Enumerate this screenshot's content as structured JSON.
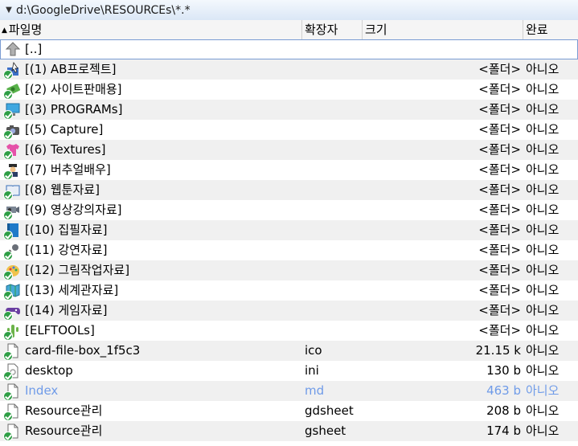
{
  "path_bar": {
    "path": "d:\\GoogleDrive\\RESOURCEs\\*.*"
  },
  "columns": {
    "name": "파일명",
    "ext": "확장자",
    "size": "크기",
    "done": "완료"
  },
  "rows": [
    {
      "name": "[..]",
      "ext": "",
      "size": "",
      "done": "",
      "icon": "up-folder-icon"
    },
    {
      "name": "[(1) AB프로젝트]",
      "ext": "",
      "size": "<폴더>",
      "done": "아니오",
      "icon": "cursor-folder-icon"
    },
    {
      "name": "[(2) 사이트판매용]",
      "ext": "",
      "size": "<폴더>",
      "done": "아니오",
      "icon": "money-icon"
    },
    {
      "name": "[(3) PROGRAMs]",
      "ext": "",
      "size": "<폴더>",
      "done": "아니오",
      "icon": "computer-icon"
    },
    {
      "name": "[(5) Capture]",
      "ext": "",
      "size": "<폴더>",
      "done": "아니오",
      "icon": "camera-icon"
    },
    {
      "name": "[(6) Textures]",
      "ext": "",
      "size": "<폴더>",
      "done": "아니오",
      "icon": "tshirt-icon"
    },
    {
      "name": "[(7) 버추얼배우]",
      "ext": "",
      "size": "<폴더>",
      "done": "아니오",
      "icon": "pilot-icon"
    },
    {
      "name": "[(8) 웹툰자료]",
      "ext": "",
      "size": "<폴더>",
      "done": "아니오",
      "icon": "book-icon"
    },
    {
      "name": "[(9) 영상강의자료]",
      "ext": "",
      "size": "<폴더>",
      "done": "아니오",
      "icon": "projector-icon"
    },
    {
      "name": "[(10) 집필자료]",
      "ext": "",
      "size": "<폴더>",
      "done": "아니오",
      "icon": "notebook-icon"
    },
    {
      "name": "[(11) 강연자료]",
      "ext": "",
      "size": "<폴더>",
      "done": "아니오",
      "icon": "microphone-icon"
    },
    {
      "name": "[(12) 그림작업자료]",
      "ext": "",
      "size": "<폴더>",
      "done": "아니오",
      "icon": "palette-icon"
    },
    {
      "name": "[(13) 세계관자료]",
      "ext": "",
      "size": "<폴더>",
      "done": "아니오",
      "icon": "map-icon"
    },
    {
      "name": "[(14) 게임자료]",
      "ext": "",
      "size": "<폴더>",
      "done": "아니오",
      "icon": "gamepad-icon"
    },
    {
      "name": "[ELFTOOLs]",
      "ext": "",
      "size": "<폴더>",
      "done": "아니오",
      "icon": "cactus-icon"
    },
    {
      "name": "card-file-box_1f5c3",
      "ext": "ico",
      "size": "21.15 k",
      "done": "아니오",
      "icon": "file-icon"
    },
    {
      "name": "desktop",
      "ext": "ini",
      "size": "130 b",
      "done": "아니오",
      "icon": "settings-file-icon"
    },
    {
      "name": "Index",
      "ext": "md",
      "size": "463 b",
      "done": "아니오",
      "icon": "file-icon"
    },
    {
      "name": "Resource관리",
      "ext": "gdsheet",
      "size": "208 b",
      "done": "아니오",
      "icon": "file-icon"
    },
    {
      "name": "Resource관리",
      "ext": "gsheet",
      "size": "174 b",
      "done": "아니오",
      "icon": "file-icon"
    }
  ],
  "colors": {
    "check": "#2e9e45",
    "dim_text": "#6f9be8",
    "alt_row": "#f0f0f0",
    "path_bar": "#dbe7f6"
  }
}
